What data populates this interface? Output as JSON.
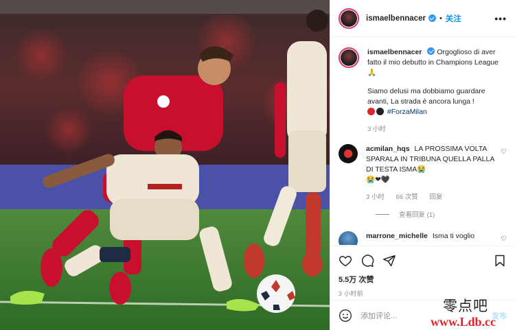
{
  "colors": {
    "accent": "#0095f6",
    "verified": "#3897f0",
    "liverpool_red": "#c8102e",
    "milan_kit": "#efe6d6"
  },
  "post_header": {
    "username": "ismaelbennacer",
    "dot": "•",
    "follow_label": "关注",
    "more_icon": "more-horizontal-icon"
  },
  "caption": {
    "username": "ismaelbennacer",
    "line1": "Orgoglioso di aver fatto il mio debutto in Champions League 🙏",
    "line2": "Siamo delusi ma dobbiamo guardare avanti, La strada è ancora lunga !",
    "hashtag": "#ForzaMilan",
    "time": "3 小时"
  },
  "comments": [
    {
      "username": "acmilan_hqs",
      "text": "LA PROSSIMA VOLTA SPARALA IN TRIBUNA QUELLA PALLA DI TESTA ISMA😭",
      "emojis": "😭❤🖤",
      "time": "3 小时",
      "likes": "66 次赞",
      "reply": "回复",
      "view_replies": "查看回复 (1)"
    },
    {
      "username": "marrone_michelle",
      "text": "Isma ti voglio"
    }
  ],
  "actions": {
    "like_icon": "heart-icon",
    "comment_icon": "comment-icon",
    "share_icon": "paper-plane-icon",
    "save_icon": "bookmark-icon",
    "likes": "5.5万 次赞",
    "time": "3 小时前"
  },
  "add_comment": {
    "placeholder": "添加评论...",
    "post_label": "发布"
  },
  "watermark": {
    "line1": "零点吧",
    "line2": "www.Ldb.cc"
  }
}
